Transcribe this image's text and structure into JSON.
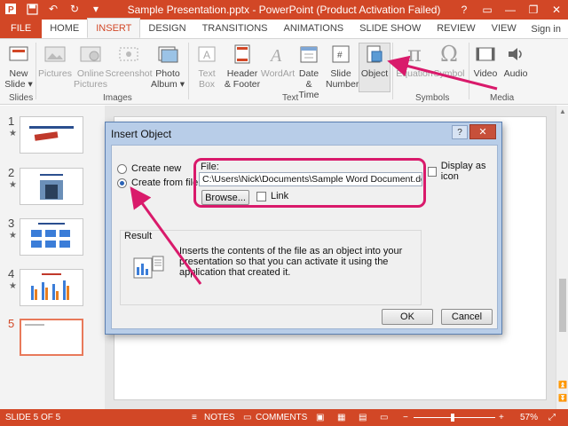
{
  "window": {
    "title": "Sample Presentation.pptx - PowerPoint (Product Activation Failed)",
    "controls": [
      "?",
      "▭",
      "—",
      "❐",
      "✕"
    ]
  },
  "quick_access": [
    "save-icon",
    "undo-icon",
    "redo-icon",
    "customize-icon"
  ],
  "tabs": [
    "FILE",
    "HOME",
    "INSERT",
    "DESIGN",
    "TRANSITIONS",
    "ANIMATIONS",
    "SLIDE SHOW",
    "REVIEW",
    "VIEW"
  ],
  "active_tab": "INSERT",
  "sign_in": "Sign in",
  "ribbon": {
    "new_slide": "New Slide ▾",
    "pictures": "Pictures",
    "online_pictures": "Online Pictures",
    "screenshot": "Screenshot",
    "photo_album": "Photo Album ▾",
    "text_box": "Text Box",
    "header_footer": "Header & Footer",
    "wordart": "WordArt",
    "date_time": "Date & Time",
    "slide_number": "Slide Number",
    "object": "Object",
    "equation": "Equation",
    "symbol": "Symbol",
    "video": "Video",
    "audio": "Audio",
    "groups": {
      "slides": "Slides",
      "images": "Images",
      "text": "Text",
      "symbols": "Symbols",
      "media": "Media"
    }
  },
  "thumbnails": [
    {
      "num": "1",
      "star": "★"
    },
    {
      "num": "2",
      "star": "★"
    },
    {
      "num": "3",
      "star": "★"
    },
    {
      "num": "4",
      "star": "★"
    },
    {
      "num": "5",
      "star": ""
    }
  ],
  "dialog": {
    "title": "Insert Object",
    "help": "?",
    "close": "✕",
    "radio_create_new": "Create new",
    "radio_create_from_file": "Create from file",
    "selected_option": "Create from file",
    "file_label": "File:",
    "file_path": "C:\\Users\\Nick\\Documents\\Sample Word Document.docx",
    "browse_button": "Browse...",
    "link_label": "Link",
    "link_checked": false,
    "display_as_icon_label": "Display as icon",
    "display_as_icon_checked": false,
    "result_label": "Result",
    "result_text": "Inserts the contents of the file as an object into your presentation so that you can activate it using the application that created it.",
    "ok_button": "OK",
    "cancel_button": "Cancel"
  },
  "status_bar": {
    "slide_info": "SLIDE 5 OF 5",
    "notes": "NOTES",
    "comments": "COMMENTS",
    "zoom_minus": "−",
    "zoom_plus": "+",
    "zoom_level": "57%"
  },
  "colors": {
    "accent": "#d24726",
    "annotation": "#d91a6b",
    "dialog_frame": "#b8cde8"
  }
}
